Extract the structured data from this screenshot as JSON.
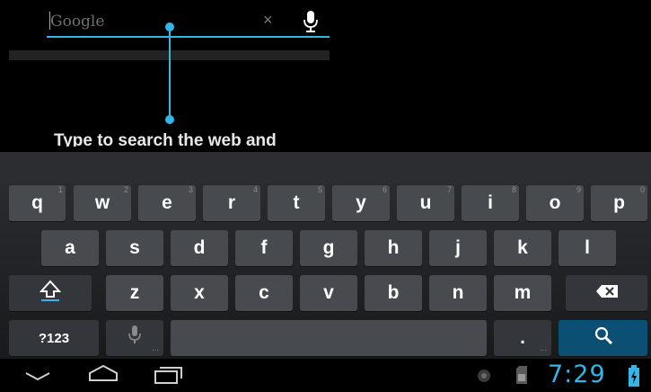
{
  "search": {
    "placeholder": "Google",
    "value": "",
    "clear_glyph": "×"
  },
  "hint": "Type to search the web and",
  "keyboard": {
    "row1": [
      {
        "label": "q",
        "hint": "1"
      },
      {
        "label": "w",
        "hint": "2"
      },
      {
        "label": "e",
        "hint": "3"
      },
      {
        "label": "r",
        "hint": "4"
      },
      {
        "label": "t",
        "hint": "5"
      },
      {
        "label": "y",
        "hint": "6"
      },
      {
        "label": "u",
        "hint": "7"
      },
      {
        "label": "i",
        "hint": "8"
      },
      {
        "label": "o",
        "hint": "9"
      },
      {
        "label": "p",
        "hint": "0"
      }
    ],
    "row2": [
      "a",
      "s",
      "d",
      "f",
      "g",
      "h",
      "j",
      "k",
      "l"
    ],
    "row3": [
      "z",
      "x",
      "c",
      "v",
      "b",
      "n",
      "m"
    ],
    "symbols_label": "?123",
    "period_label": "."
  },
  "status": {
    "time": "7:29"
  },
  "colors": {
    "accent": "#33b5e5",
    "key": "#474b50",
    "search_key": "#0b4f74"
  },
  "icons": {
    "shift": "shift-icon",
    "backspace": "backspace-icon",
    "mic": "mic-icon",
    "search": "search-icon",
    "back": "back-icon",
    "home": "home-icon",
    "recents": "recents-icon",
    "notification": "notification-icon",
    "sd_card": "sd-card-icon",
    "battery": "battery-charging-icon"
  }
}
